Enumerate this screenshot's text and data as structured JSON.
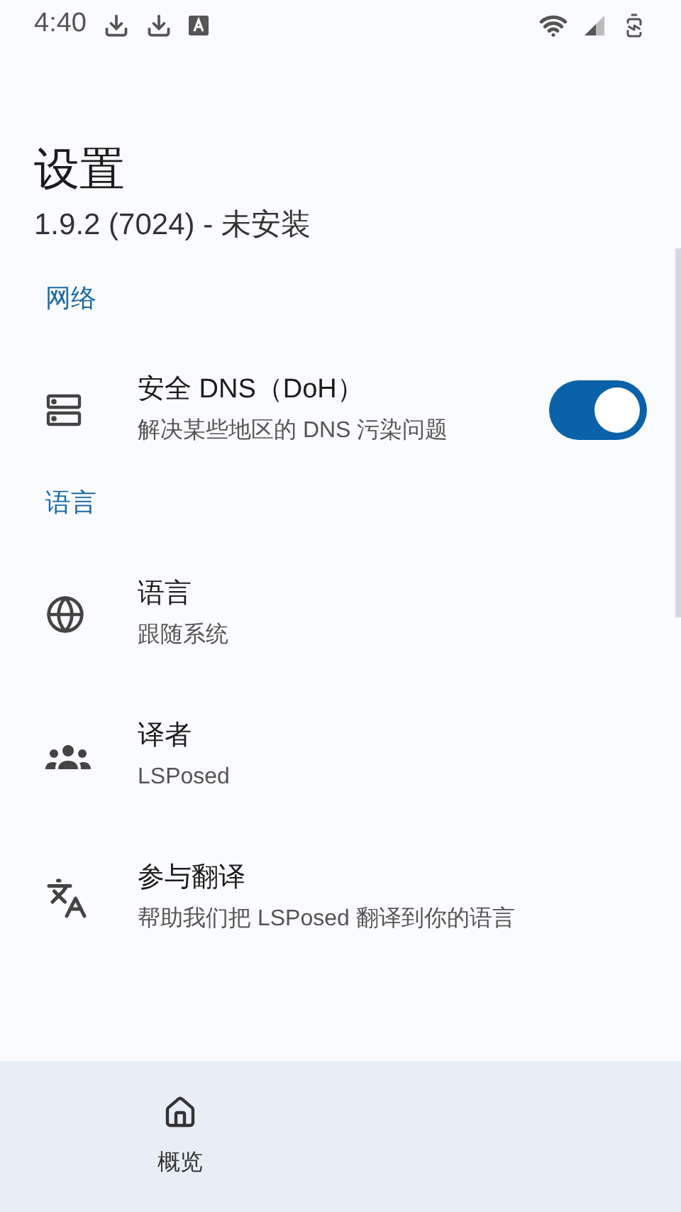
{
  "status_bar": {
    "time": "4:40"
  },
  "header": {
    "title": "设置",
    "subtitle": "1.9.2 (7024) - 未安装"
  },
  "sections": [
    {
      "title": "网络",
      "items": [
        {
          "kind": "switch",
          "title": "安全 DNS（DoH）",
          "summary": "解决某些地区的 DNS 污染问题",
          "on": true
        }
      ]
    },
    {
      "title": "语言",
      "items": [
        {
          "kind": "plain",
          "title": "语言",
          "summary": "跟随系统"
        },
        {
          "kind": "plain",
          "title": "译者",
          "summary": "LSPosed"
        },
        {
          "kind": "plain",
          "title": "参与翻译",
          "summary": "帮助我们把 LSPosed 翻译到你的语言"
        }
      ]
    }
  ],
  "bottom_nav": [
    {
      "label": "概览",
      "selected": false
    }
  ]
}
